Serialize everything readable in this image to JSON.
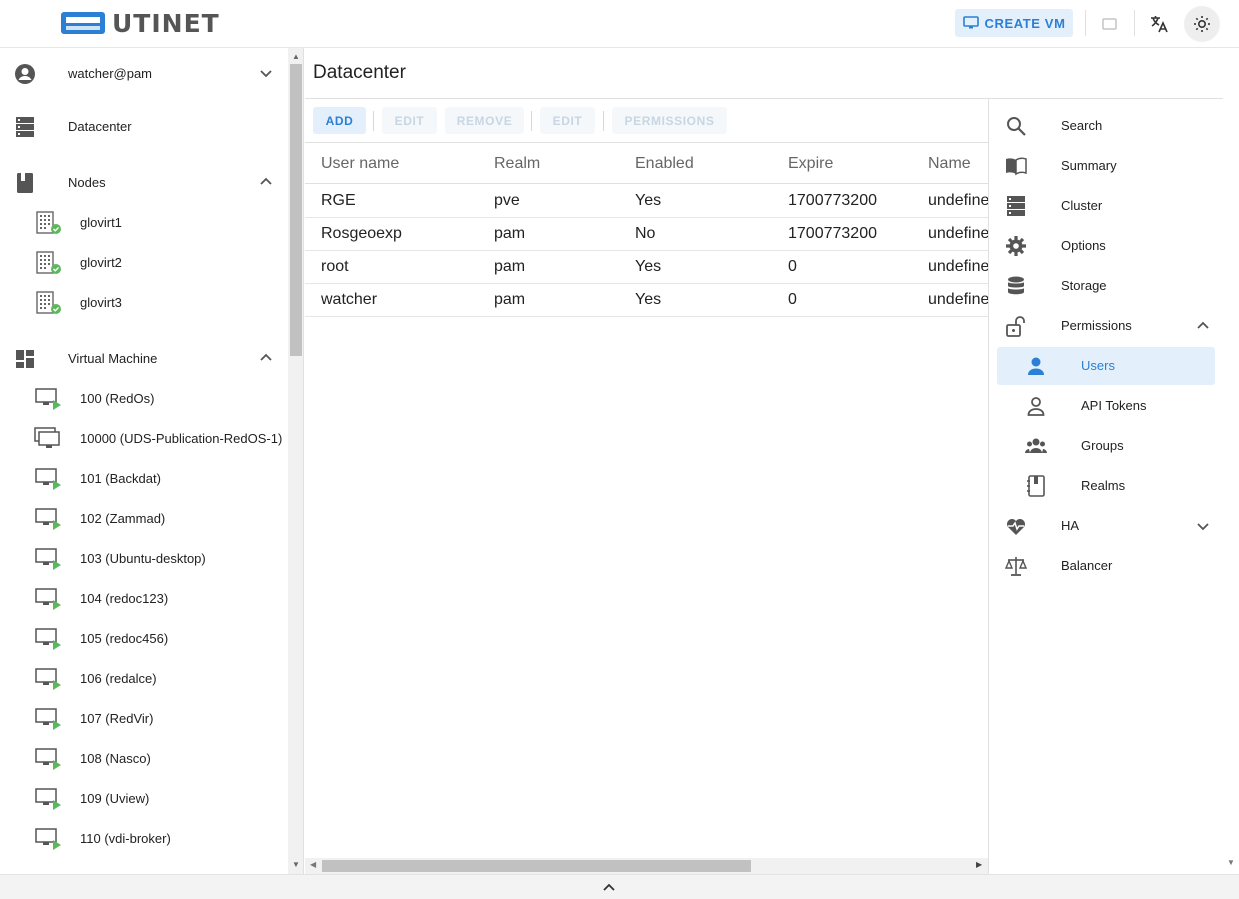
{
  "header": {
    "logo_text": "UTINET",
    "create_vm_label": "CREATE VM"
  },
  "sidebar": {
    "user": "watcher@pam",
    "datacenter": "Datacenter",
    "nodes_label": "Nodes",
    "nodes": [
      "glovirt1",
      "glovirt2",
      "glovirt3"
    ],
    "vm_label": "Virtual Machine",
    "vms": [
      "100 (RedOs)",
      "10000 (UDS-Publication-RedOS-1)",
      "101 (Backdat)",
      "102 (Zammad)",
      "103 (Ubuntu-desktop)",
      "104 (redoc123)",
      "105 (redoc456)",
      "106 (redalce)",
      "107 (RedVir)",
      "108 (Nasco)",
      "109 (Uview)",
      "110 (vdi-broker)"
    ]
  },
  "main": {
    "title": "Datacenter",
    "toolbar": {
      "add": "ADD",
      "edit": "EDIT",
      "remove": "REMOVE",
      "edit2": "EDIT",
      "permissions": "PERMISSIONS"
    },
    "columns": [
      "User name",
      "Realm",
      "Enabled",
      "Expire",
      "Name"
    ],
    "rows": [
      [
        "RGE",
        "pve",
        "Yes",
        "1700773200",
        "undefined"
      ],
      [
        "Rosgeoexp",
        "pam",
        "No",
        "1700773200",
        "undefined"
      ],
      [
        "root",
        "pam",
        "Yes",
        "0",
        "undefined"
      ],
      [
        "watcher",
        "pam",
        "Yes",
        "0",
        "undefined"
      ]
    ]
  },
  "right_panel": {
    "items": [
      {
        "label": "Search",
        "icon": "search-icon"
      },
      {
        "label": "Summary",
        "icon": "book-icon"
      },
      {
        "label": "Cluster",
        "icon": "server-icon"
      },
      {
        "label": "Options",
        "icon": "gear-icon"
      },
      {
        "label": "Storage",
        "icon": "database-icon"
      },
      {
        "label": "Permissions",
        "icon": "unlock-icon"
      },
      {
        "label": "Users",
        "icon": "person-icon"
      },
      {
        "label": "API Tokens",
        "icon": "person-outline-icon"
      },
      {
        "label": "Groups",
        "icon": "groups-icon"
      },
      {
        "label": "Realms",
        "icon": "notebook-icon"
      },
      {
        "label": "HA",
        "icon": "heart-monitor-icon"
      },
      {
        "label": "Balancer",
        "icon": "scale-icon"
      }
    ]
  },
  "colors": {
    "accent": "#2b7fd4",
    "accent_bg": "#e3f0fc",
    "status_green": "#5cb85c"
  }
}
